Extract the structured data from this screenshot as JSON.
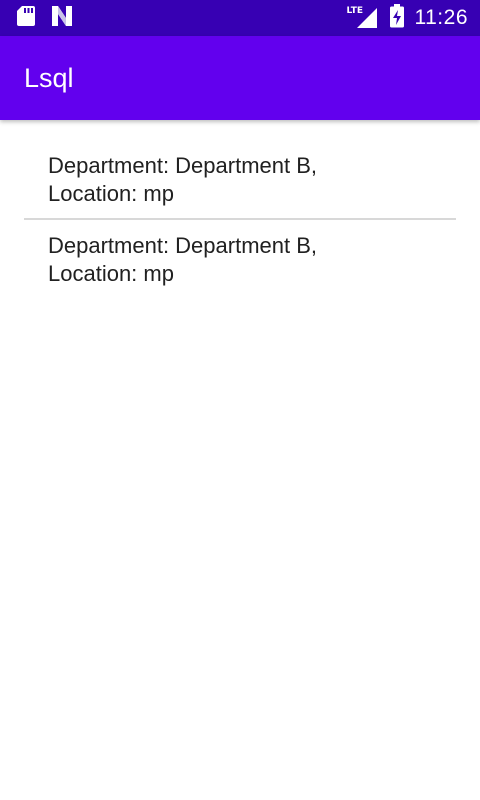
{
  "status_bar": {
    "time": "11:26",
    "icons": [
      "sd-card-icon",
      "n-logo-icon",
      "lte-signal-icon",
      "battery-charging-icon"
    ],
    "network_label": "LTE"
  },
  "app_bar": {
    "title": "Lsql"
  },
  "list": {
    "items": [
      {
        "line1": "Department: Department B,",
        "line2": "Location: mp"
      },
      {
        "line1": "Department: Department B,",
        "line2": "Location: mp"
      }
    ]
  },
  "colors": {
    "status_bar": "#3700b3",
    "app_bar": "#6200ee",
    "text": "#212121",
    "divider": "#d8d8d8"
  }
}
